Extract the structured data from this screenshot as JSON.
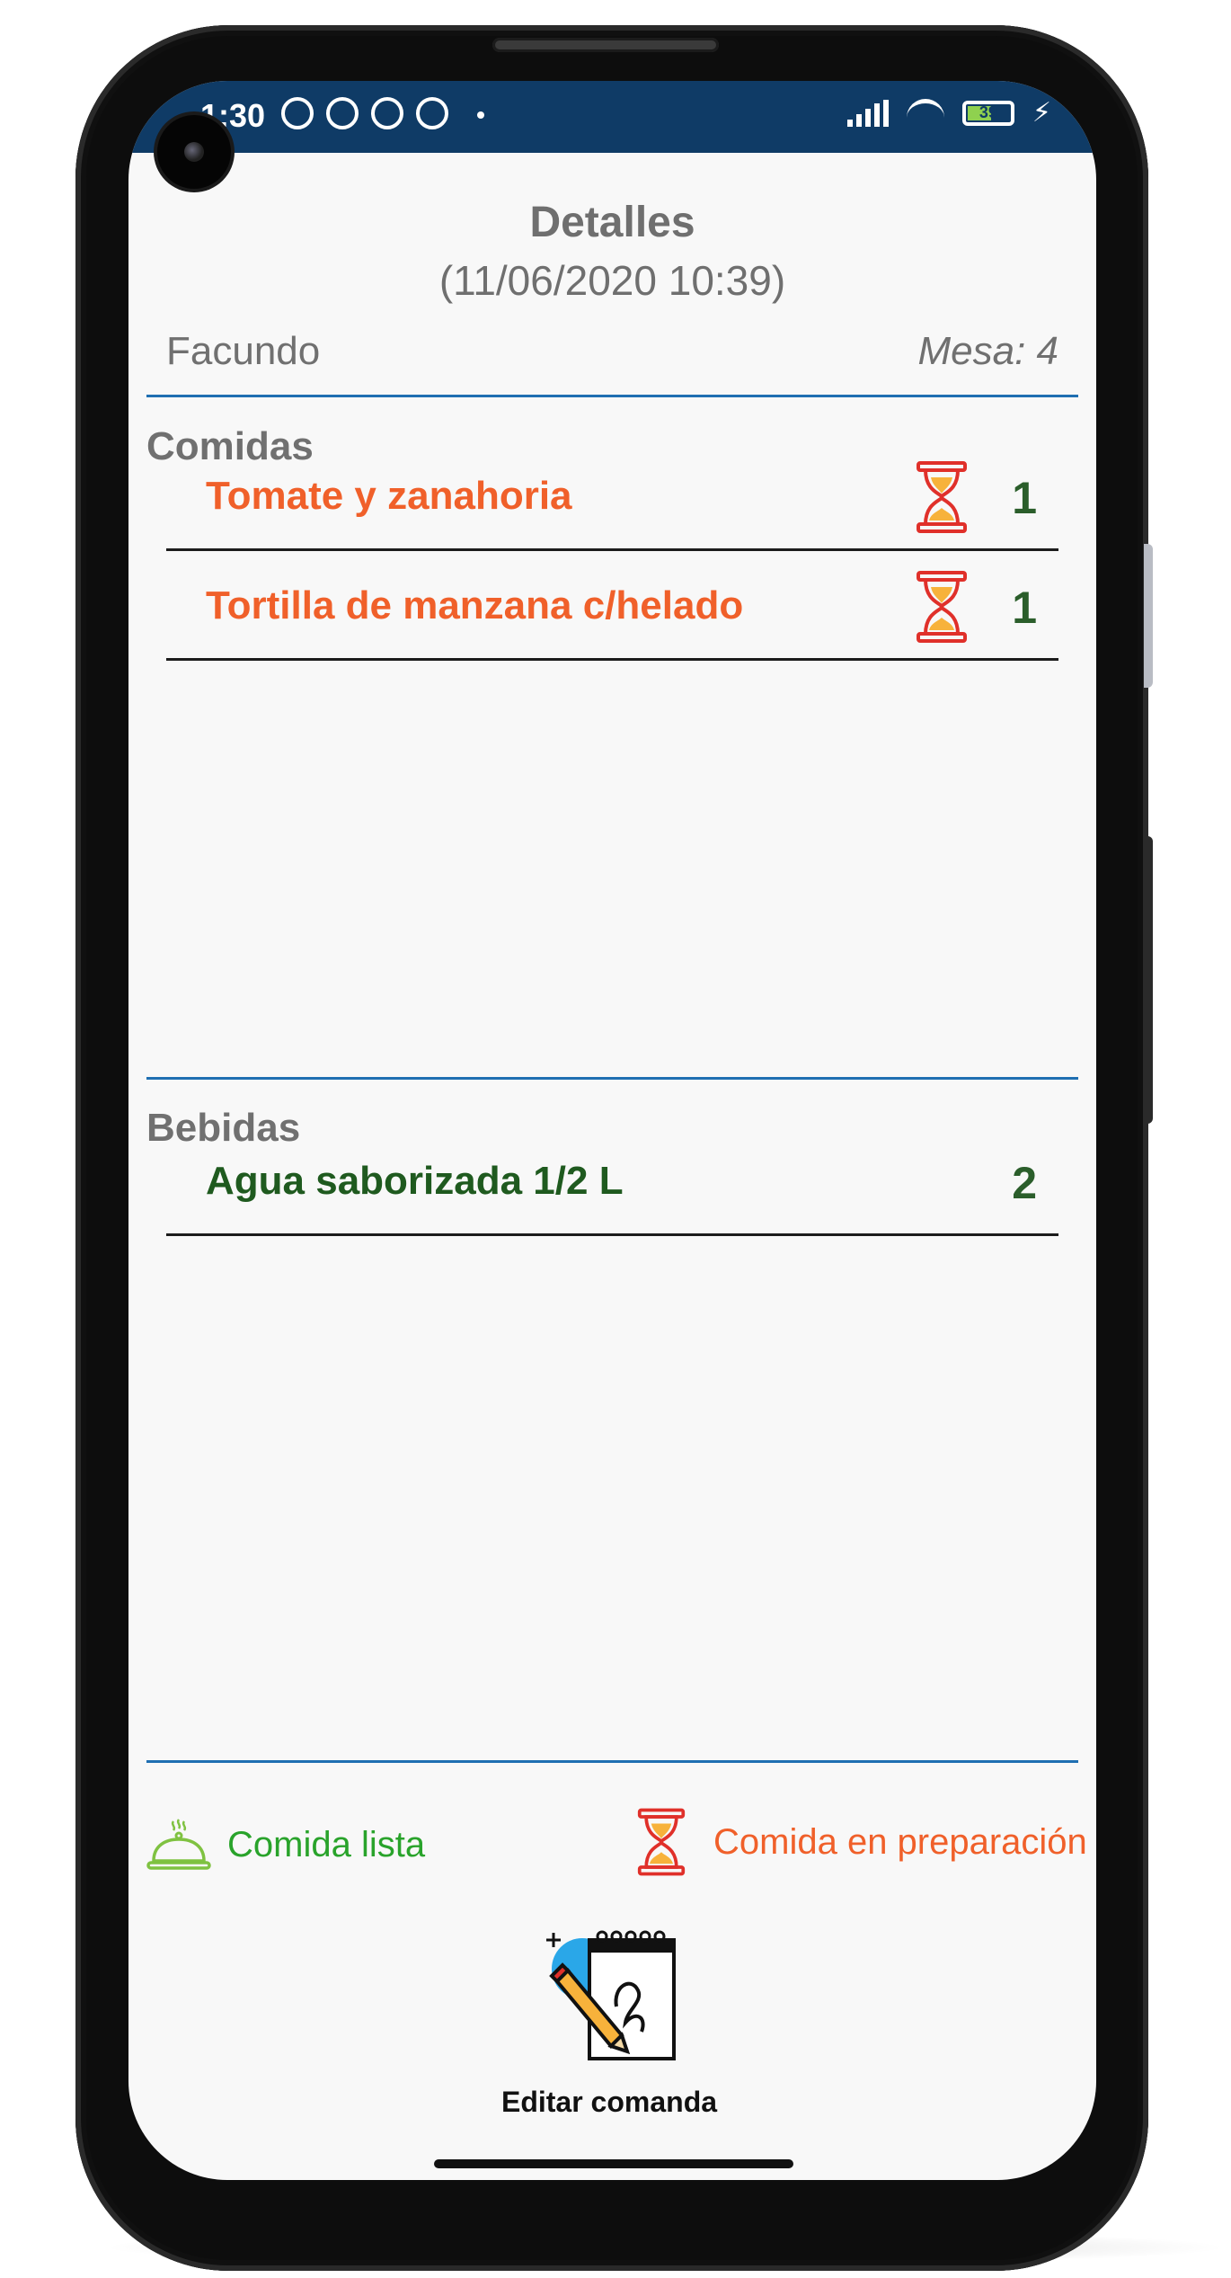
{
  "status_bar": {
    "time": "1:30",
    "battery": "39",
    "bg_color": "#0f3b66"
  },
  "header": {
    "title": "Detalles",
    "datetime": "(11/06/2020 10:39)",
    "waiter": "Facundo",
    "table": "Mesa: 4"
  },
  "comidas": {
    "title": "Comidas",
    "items": [
      {
        "name": "Tomate y zanahoria",
        "qty": "1",
        "status": "hourglass-icon"
      },
      {
        "name": "Tortilla de manzana c/helado",
        "qty": "1",
        "status": "hourglass-icon"
      }
    ]
  },
  "bebidas": {
    "title": "Bebidas",
    "items": [
      {
        "name": "Agua saborizada 1/2 L",
        "qty": "2"
      }
    ]
  },
  "legend": {
    "ready": "Comida lista",
    "preparing": "Comida en preparación"
  },
  "actions": {
    "edit": "Editar comanda"
  },
  "colors": {
    "accent_blue": "#1f6fb2",
    "orange": "#f0602a",
    "green_text": "#1f5a1f",
    "ready_green": "#29a32b"
  }
}
